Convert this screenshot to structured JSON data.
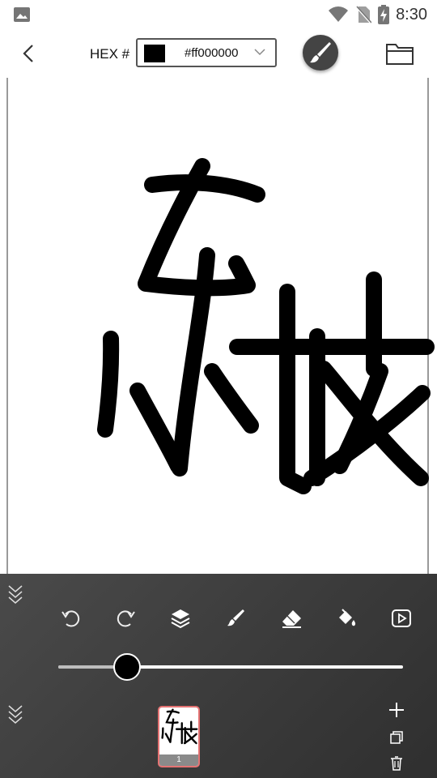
{
  "status_bar": {
    "time": "8:30"
  },
  "toolbar": {
    "hex_label": "HEX #",
    "hex_value": "#ff000000",
    "swatch_color": "#000000"
  },
  "layers": [
    {
      "number": "1"
    }
  ],
  "slider": {
    "value": 0.2
  },
  "colors": {
    "panel_bg": "#3c3c3c",
    "selected_layer_border": "#e57373"
  }
}
